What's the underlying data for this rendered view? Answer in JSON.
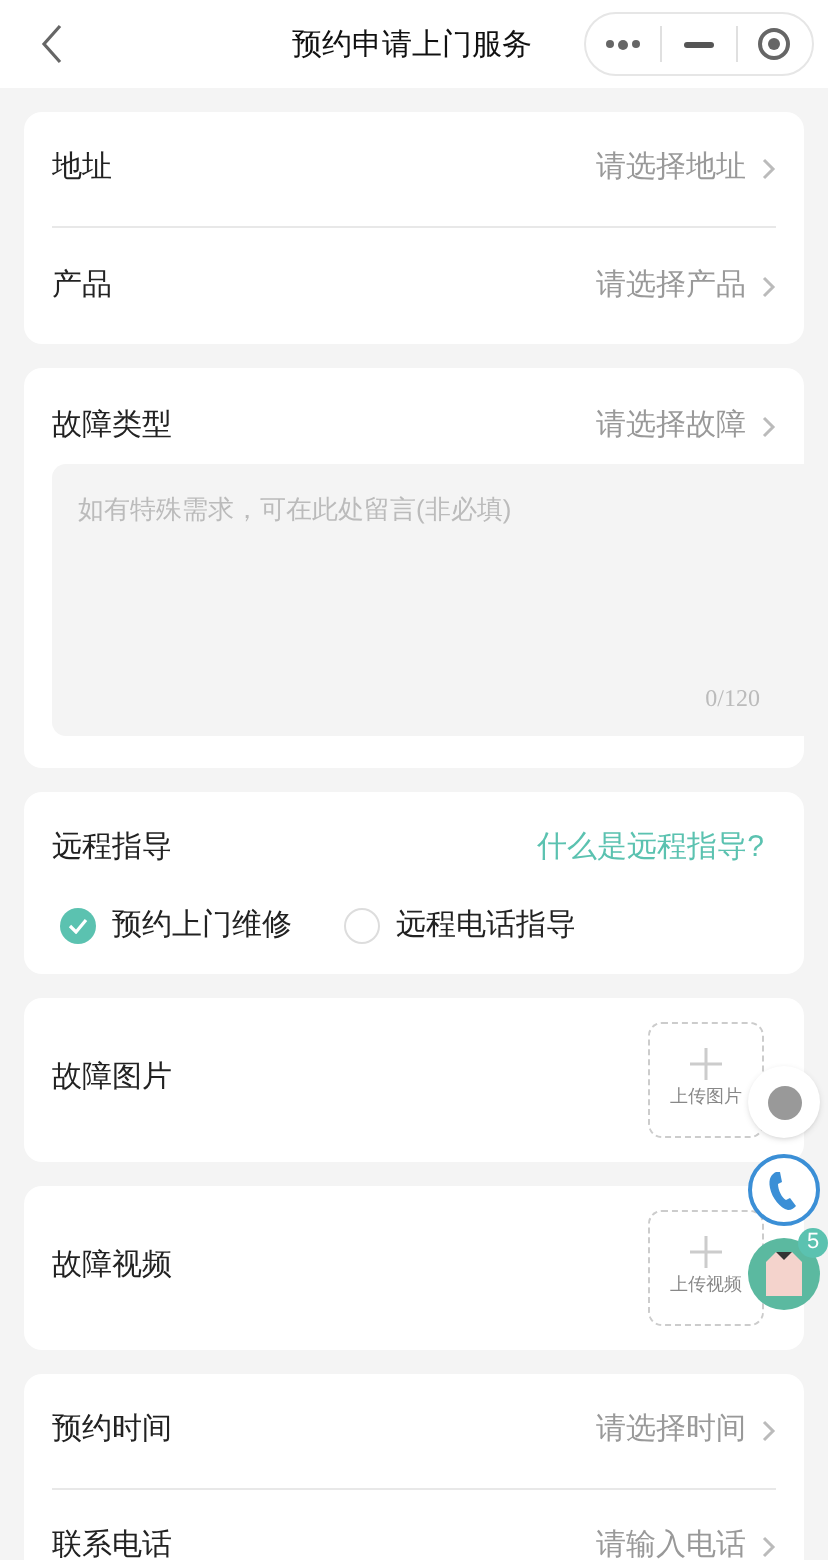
{
  "header": {
    "title": "预约申请上门服务"
  },
  "address_card": {
    "rows": [
      {
        "label": "地址",
        "placeholder": "请选择地址"
      },
      {
        "label": "产品",
        "placeholder": "请选择产品"
      }
    ]
  },
  "fault_card": {
    "label": "故障类型",
    "placeholder": "请选择故障",
    "note": {
      "placeholder": "如有特殊需求，可在此处留言(非必填)",
      "counter": "0/120"
    }
  },
  "remote_card": {
    "label": "远程指导",
    "link": "什么是远程指导?",
    "options": [
      {
        "label": "预约上门维修",
        "selected": true
      },
      {
        "label": "远程电话指导",
        "selected": false
      }
    ]
  },
  "upload_cards": [
    {
      "label": "故障图片",
      "button": "上传图片"
    },
    {
      "label": "故障视频",
      "button": "上传视频"
    }
  ],
  "time_card": {
    "rows": [
      {
        "label": "预约时间",
        "placeholder": "请选择时间"
      },
      {
        "label": "联系电话",
        "placeholder": "请输入电话"
      }
    ]
  },
  "floating": {
    "badge": "5"
  }
}
